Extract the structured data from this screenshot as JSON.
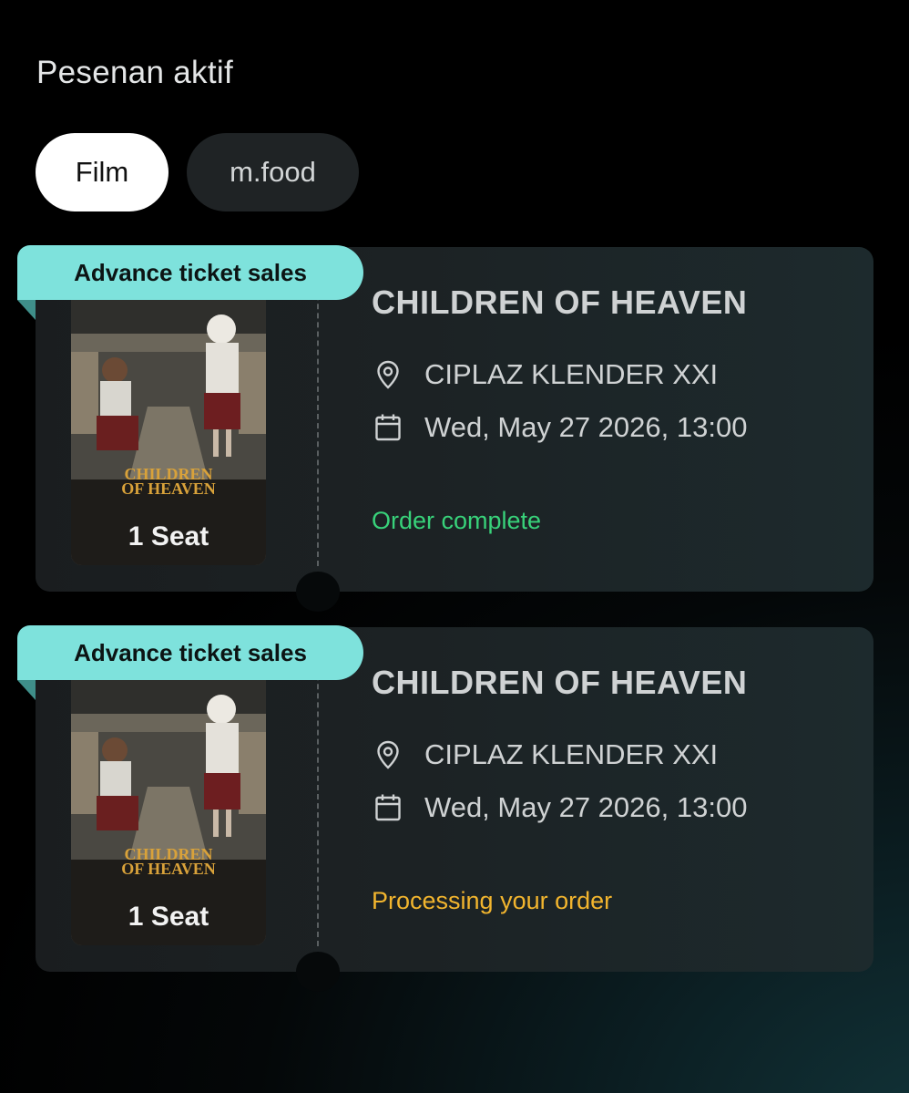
{
  "header": {
    "title": "Pesenan aktif"
  },
  "tabs": [
    {
      "label": "Film",
      "active": true
    },
    {
      "label": "m.food",
      "active": false
    }
  ],
  "orders": [
    {
      "badge": "Advance ticket sales",
      "poster_text": {
        "line1": "CHILDREN",
        "line2": "OF HEAVEN"
      },
      "seats": "1 Seat",
      "title": "CHILDREN OF HEAVEN",
      "icons": {
        "location": "location-pin-icon",
        "date": "calendar-icon"
      },
      "location": "CIPLAZ KLENDER XXI",
      "datetime": "Wed, May 27 2026, 13:00",
      "status": "Order complete",
      "status_color": "#38d27a"
    },
    {
      "badge": "Advance ticket sales",
      "poster_text": {
        "line1": "CHILDREN",
        "line2": "OF HEAVEN"
      },
      "seats": "1 Seat",
      "title": "CHILDREN OF HEAVEN",
      "icons": {
        "location": "location-pin-icon",
        "date": "calendar-icon"
      },
      "location": "CIPLAZ KLENDER XXI",
      "datetime": "Wed, May 27 2026, 13:00",
      "status": "Processing your order",
      "status_color": "#f2b52e"
    }
  ],
  "colors": {
    "badge_bg": "#7ee2dc",
    "tab_active_bg": "#ffffff",
    "tab_inactive_bg": "#1f2325"
  }
}
